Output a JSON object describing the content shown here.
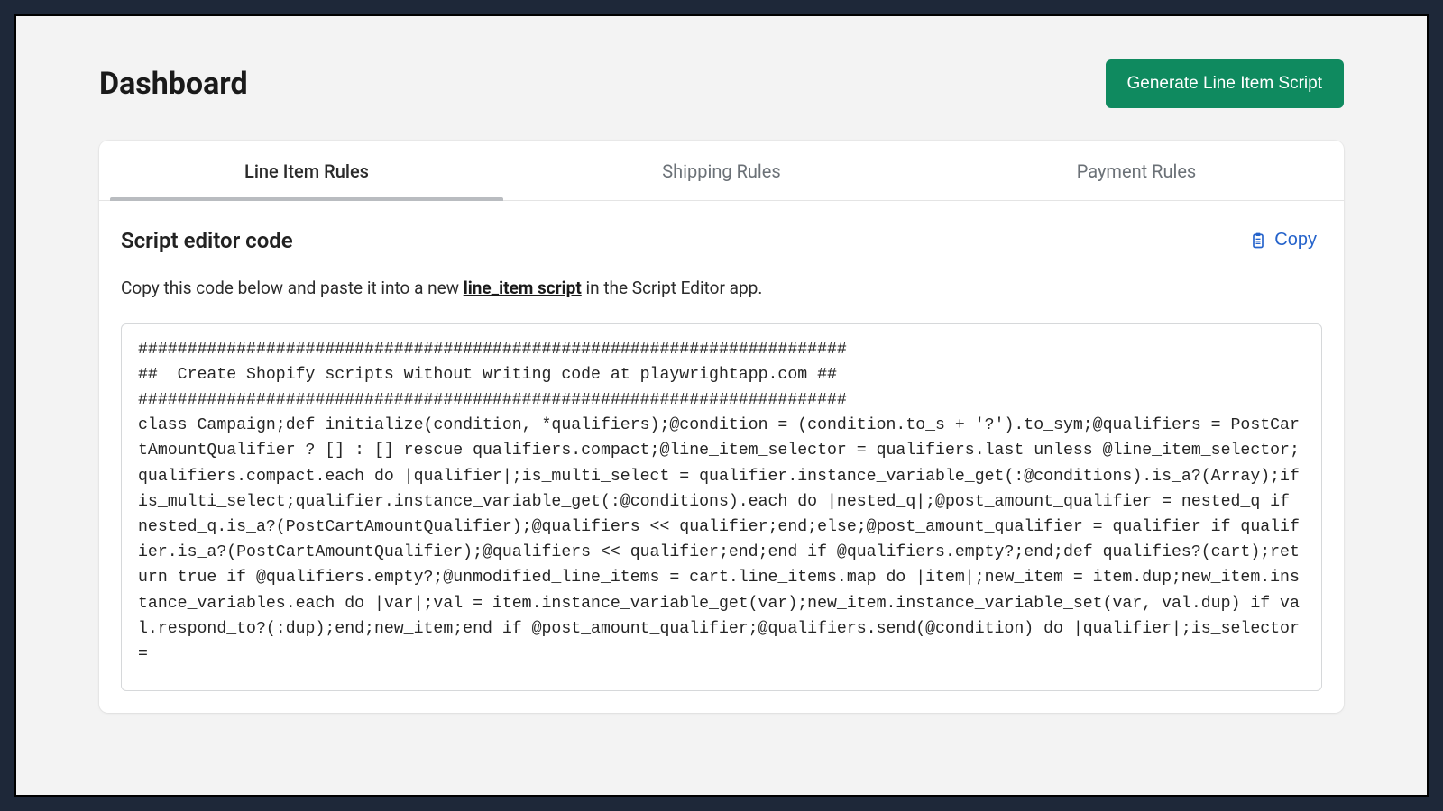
{
  "header": {
    "title": "Dashboard",
    "primary_button": "Generate Line Item Script"
  },
  "tabs": [
    {
      "label": "Line Item Rules",
      "active": true
    },
    {
      "label": "Shipping Rules",
      "active": false
    },
    {
      "label": "Payment Rules",
      "active": false
    }
  ],
  "section": {
    "title": "Script editor code",
    "copy_label": "Copy",
    "instruction_pre": "Copy this code below and paste it into a new ",
    "instruction_link": "line_item script",
    "instruction_post": " in the Script Editor app."
  },
  "code": "########################################################################\n##  Create Shopify scripts without writing code at playwrightapp.com ##\n########################################################################\nclass Campaign;def initialize(condition, *qualifiers);@condition = (condition.to_s + '?').to_sym;@qualifiers = PostCartAmountQualifier ? [] : [] rescue qualifiers.compact;@line_item_selector = qualifiers.last unless @line_item_selector;qualifiers.compact.each do |qualifier|;is_multi_select = qualifier.instance_variable_get(:@conditions).is_a?(Array);if is_multi_select;qualifier.instance_variable_get(:@conditions).each do |nested_q|;@post_amount_qualifier = nested_q if nested_q.is_a?(PostCartAmountQualifier);@qualifiers << qualifier;end;else;@post_amount_qualifier = qualifier if qualifier.is_a?(PostCartAmountQualifier);@qualifiers << qualifier;end;end if @qualifiers.empty?;end;def qualifies?(cart);return true if @qualifiers.empty?;@unmodified_line_items = cart.line_items.map do |item|;new_item = item.dup;new_item.instance_variables.each do |var|;val = item.instance_variable_get(var);new_item.instance_variable_set(var, val.dup) if val.respond_to?(:dup);end;new_item;end if @post_amount_qualifier;@qualifiers.send(@condition) do |qualifier|;is_selector ="
}
